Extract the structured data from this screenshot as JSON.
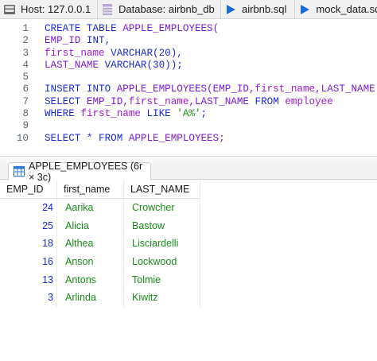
{
  "tabs": [
    {
      "label": "Host: 127.0.0.1",
      "icon": "host-icon"
    },
    {
      "label": "Database: airbnb_db",
      "icon": "database-icon"
    },
    {
      "label": "airbnb.sql",
      "icon": "play-icon"
    },
    {
      "label": "mock_data.sql",
      "icon": "play-icon"
    }
  ],
  "editor": {
    "line_numbers": [
      "1",
      "2",
      "3",
      "4",
      "5",
      "6",
      "7",
      "8",
      "9",
      "10"
    ],
    "lines": [
      [
        {
          "t": "CREATE TABLE ",
          "c": "kw"
        },
        {
          "t": "APPLE_EMPLOYEES(",
          "c": "tname"
        }
      ],
      [
        {
          "t": "EMP_ID ",
          "c": "tname"
        },
        {
          "t": "INT,",
          "c": "kw"
        }
      ],
      [
        {
          "t": "first_name ",
          "c": "col"
        },
        {
          "t": "VARCHAR",
          "c": "kw"
        },
        {
          "t": "(20),",
          "c": "kw"
        }
      ],
      [
        {
          "t": "LAST_NAME ",
          "c": "tname"
        },
        {
          "t": "VARCHAR",
          "c": "kw"
        },
        {
          "t": "(30));",
          "c": "kw"
        }
      ],
      [],
      [
        {
          "t": "INSERT INTO ",
          "c": "kw"
        },
        {
          "t": "APPLE_EMPLOYEES(EMP_ID,",
          "c": "tname"
        },
        {
          "t": "first_name",
          "c": "col"
        },
        {
          "t": ",LAST_NAME)",
          "c": "tname"
        }
      ],
      [
        {
          "t": "SELECT ",
          "c": "kw"
        },
        {
          "t": "EMP_ID,",
          "c": "tname"
        },
        {
          "t": "first_name",
          "c": "col"
        },
        {
          "t": ",LAST_NAME ",
          "c": "tname"
        },
        {
          "t": "FROM ",
          "c": "kw"
        },
        {
          "t": "employee",
          "c": "col"
        }
      ],
      [
        {
          "t": "WHERE ",
          "c": "kw"
        },
        {
          "t": "first_name ",
          "c": "col"
        },
        {
          "t": "LIKE ",
          "c": "kw"
        },
        {
          "t": "'A%'",
          "c": "str"
        },
        {
          "t": ";",
          "c": "kw"
        }
      ],
      [],
      [
        {
          "t": "SELECT * FROM ",
          "c": "kw"
        },
        {
          "t": "APPLE_EMPLOYEES;",
          "c": "tname"
        }
      ]
    ]
  },
  "result_tab": {
    "label": "APPLE_EMPLOYEES (6r × 3c)"
  },
  "grid": {
    "columns": [
      "EMP_ID",
      "first_name",
      "LAST_NAME"
    ],
    "rows": [
      [
        "24",
        "Aarika",
        "Crowcher"
      ],
      [
        "25",
        "Alicia",
        "Bastow"
      ],
      [
        "18",
        "Althea",
        "Lisciardelli"
      ],
      [
        "16",
        "Anson",
        "Lockwood"
      ],
      [
        "13",
        "Antons",
        "Tolmie"
      ],
      [
        "3",
        "Arlinda",
        "Kiwitz"
      ]
    ]
  }
}
